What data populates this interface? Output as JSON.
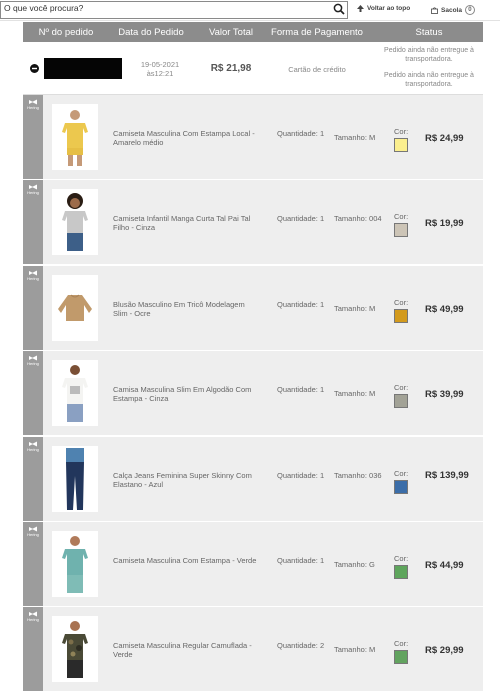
{
  "search": {
    "placeholder": "O que você procura?"
  },
  "nav": {
    "back_to_top": "Voltar ao topo",
    "bag": "Sacola",
    "bag_count": "0"
  },
  "table": {
    "headers": [
      "Nº do pedido",
      "Data do Pedido",
      "Valor Total",
      "Forma de Pagamento",
      "Status"
    ]
  },
  "order": {
    "date": "19-05-2021",
    "time": "às12:21",
    "total": "R$ 21,98",
    "payment": "Cartão de crédito",
    "status_1": "Pedido ainda não entregue à transportadora.",
    "status_2": "Pedido ainda não entregue à transportadora."
  },
  "brand_label": "Hering",
  "color_label": "Cor:",
  "items": [
    {
      "name": "Camiseta Masculina Com Estampa Local - Amarelo médio",
      "qty": "Quantidade: 1",
      "size": "Tamanho: M",
      "color": "#fbef8e",
      "price": "R$ 24,99"
    },
    {
      "name": "Camiseta Infantil Manga Curta Tal Pai Tal Filho - Cinza",
      "qty": "Quantidade: 1",
      "size": "Tamanho: 004",
      "color": "#ccc4b6",
      "price": "R$ 19,99"
    },
    {
      "name": "Blusão Masculino Em Tricô Modelagem Slim - Ocre",
      "qty": "Quantidade: 1",
      "size": "Tamanho: M",
      "color": "#d39a1c",
      "price": "R$ 49,99"
    },
    {
      "name": "Camisa Masculina Slim Em Algodão Com Estampa - Cinza",
      "qty": "Quantidade: 1",
      "size": "Tamanho: M",
      "color": "#a2a296",
      "price": "R$ 39,99"
    },
    {
      "name": "Calça Jeans Feminina Super Skinny Com Elastano - Azul",
      "qty": "Quantidade: 1",
      "size": "Tamanho: 036",
      "color": "#3b6da8",
      "price": "R$ 139,99"
    },
    {
      "name": "Camiseta Masculina Com Estampa - Verde",
      "qty": "Quantidade: 1",
      "size": "Tamanho: G",
      "color": "#5ea55c",
      "price": "R$ 44,99"
    },
    {
      "name": "Camiseta Masculina Regular Camuflada - Verde",
      "qty": "Quantidade: 2",
      "size": "Tamanho: M",
      "color": "#62a35f",
      "price": "R$ 29,99"
    }
  ]
}
